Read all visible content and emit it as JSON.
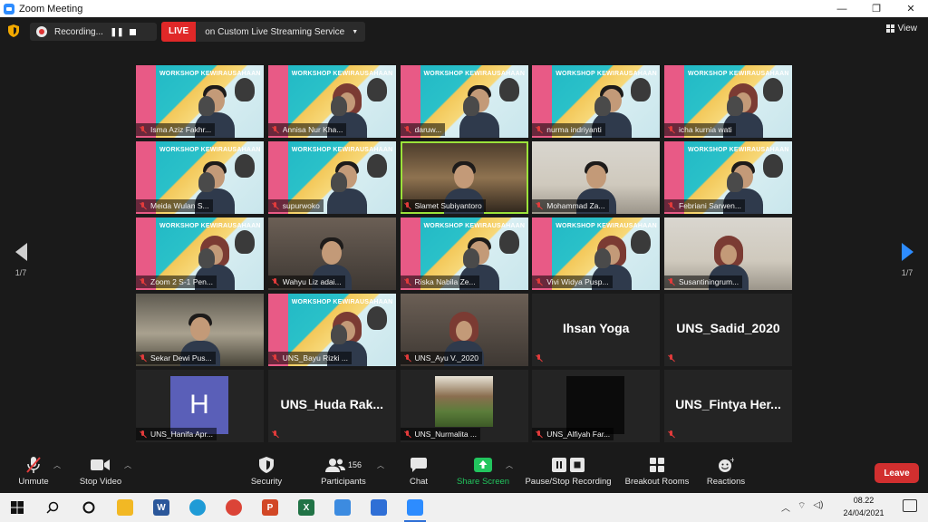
{
  "window": {
    "title": "Zoom Meeting",
    "controls": [
      "—",
      "❐",
      "✕"
    ]
  },
  "topbar": {
    "recording_label": "Recording...",
    "live_badge": "LIVE",
    "live_text": "on Custom Live Streaming Service",
    "view_label": "View"
  },
  "pager": {
    "left_label": "1/7",
    "right_label": "1/7"
  },
  "slide": {
    "title": "WORKSHOP KEWIRAUSAHAAN"
  },
  "participants": [
    {
      "name": "Isma Aziz Fakhr...",
      "kind": "slide"
    },
    {
      "name": "Annisa Nur Kha...",
      "kind": "slide-cam"
    },
    {
      "name": "daruw...",
      "kind": "slide-cam"
    },
    {
      "name": "nurma indriyanti",
      "kind": "slide-cam"
    },
    {
      "name": "icha kurnia wati",
      "kind": "slide-cam"
    },
    {
      "name": "Meida Wulan S...",
      "kind": "slide-cam"
    },
    {
      "name": "supurwoko",
      "kind": "slide-cam"
    },
    {
      "name": "Slamet Subiyantoro",
      "kind": "cam",
      "active": true
    },
    {
      "name": "Mohammad Za...",
      "kind": "cam"
    },
    {
      "name": "Febriani Sarwen...",
      "kind": "slide-cam"
    },
    {
      "name": "Zoom 2 S-1 Pen...",
      "kind": "slide-cam"
    },
    {
      "name": "Wahyu Liz adai...",
      "kind": "cam"
    },
    {
      "name": "Riska Nabila Ze...",
      "kind": "slide-cam"
    },
    {
      "name": "Vivi Widya Pusp...",
      "kind": "slide-cam"
    },
    {
      "name": "Susantiningrum...",
      "kind": "cam"
    },
    {
      "name": "Sekar Dewi Pus...",
      "kind": "cam"
    },
    {
      "name": "UNS_Bayu Rizki ...",
      "kind": "slide-cam"
    },
    {
      "name": "UNS_Ayu V._2020",
      "kind": "cam"
    },
    {
      "name": "",
      "kind": "bigname",
      "bigname": "Ihsan Yoga"
    },
    {
      "name": "",
      "kind": "bigname",
      "bigname": "UNS_Sadid_2020"
    },
    {
      "name": "UNS_Hanifa Apr...",
      "kind": "avatar",
      "initial": "H"
    },
    {
      "name": "",
      "kind": "bigname",
      "bigname": "UNS_Huda  Rak..."
    },
    {
      "name": "UNS_Nurmalita ...",
      "kind": "photo"
    },
    {
      "name": "UNS_Alfiyah Far...",
      "kind": "black"
    },
    {
      "name": "",
      "kind": "bigname",
      "bigname": "UNS_Fintya  Her..."
    }
  ],
  "toolbar": {
    "unmute": "Unmute",
    "stop_video": "Stop Video",
    "security": "Security",
    "participants": "Participants",
    "participants_count": "156",
    "chat": "Chat",
    "share_screen": "Share Screen",
    "pause_stop_recording": "Pause/Stop Recording",
    "breakout_rooms": "Breakout Rooms",
    "reactions": "Reactions",
    "leave": "Leave"
  },
  "taskbar": {
    "time": "08.22",
    "date": "24/04/2021",
    "apps": [
      {
        "icon": "file-explorer-icon",
        "color": "#f2b824"
      },
      {
        "icon": "word-icon",
        "color": "#2b579a",
        "glyph": "W"
      },
      {
        "icon": "edge-icon",
        "color": "#1f9bd6"
      },
      {
        "icon": "chrome-icon",
        "color": "#db4437"
      },
      {
        "icon": "powerpoint-icon",
        "color": "#d24726",
        "glyph": "P"
      },
      {
        "icon": "excel-icon",
        "color": "#217346",
        "glyph": "X"
      },
      {
        "icon": "folder-blue-icon",
        "color": "#3c8be0"
      },
      {
        "icon": "app-blue-icon",
        "color": "#2f6fd6"
      },
      {
        "icon": "zoom-icon",
        "color": "#2d8cff"
      }
    ]
  }
}
